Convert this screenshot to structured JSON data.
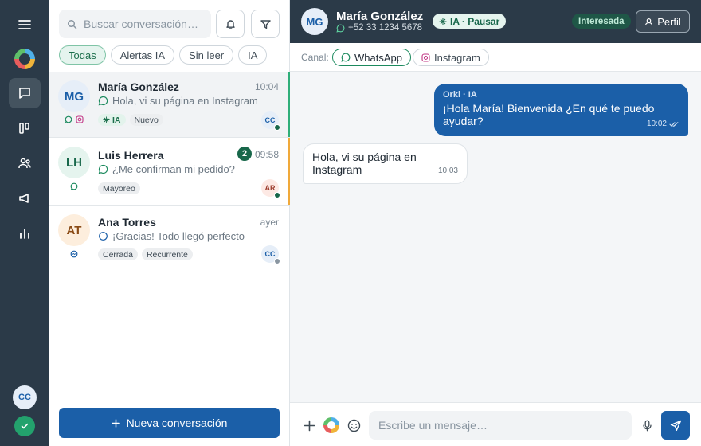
{
  "nav": {
    "items": [
      "menu-icon",
      "chat-icon",
      "board-icon",
      "users-icon",
      "megaphone-icon",
      "chart-icon"
    ],
    "active": "chat-icon",
    "user_initials": "CC",
    "status": "online"
  },
  "list": {
    "search_placeholder": "Buscar conversación…",
    "filters": [
      {
        "label": "Todas",
        "active": true
      },
      {
        "label": "Alertas IA",
        "active": false
      },
      {
        "label": "Sin leer",
        "active": false
      },
      {
        "label": "IA",
        "active": false
      }
    ],
    "conversations": [
      {
        "initials": "MG",
        "name": "María González",
        "time": "10:04",
        "preview": "Hola, vi su página en Instagram",
        "tags": [
          "IA",
          "Nuevo"
        ],
        "agent": "CC",
        "agent_status_color": "#17674a",
        "accent": "#2fae79",
        "channels": [
          "whatsapp",
          "instagram"
        ],
        "selected": true
      },
      {
        "initials": "LH",
        "name": "Luis Herrera",
        "time": "09:58",
        "unread": "2",
        "preview": "¿Me confirman mi pedido?",
        "tags": [
          "Mayoreo"
        ],
        "agent": "AR",
        "agent_status_color": "#17674a",
        "accent": "#f0a93a",
        "channels": [
          "whatsapp"
        ],
        "selected": false
      },
      {
        "initials": "AT",
        "name": "Ana Torres",
        "time": "ayer",
        "preview": "¡Gracias! Todo llegó perfecto",
        "tags": [
          "Cerrada",
          "Recurrente"
        ],
        "agent": "CC",
        "agent_status_color": "#8a96a1",
        "accent": "",
        "channels": [
          "messenger"
        ],
        "selected": false
      }
    ],
    "new_button": "Nueva conversación"
  },
  "chat": {
    "header": {
      "initials": "MG",
      "name": "María González",
      "phone": "+52 33 1234 5678",
      "ia_toggle": "IA · Pausar",
      "status": "Interesada",
      "profile_button": "Perfil"
    },
    "channel_label": "Canal:",
    "channels": [
      {
        "label": "WhatsApp",
        "active": true
      },
      {
        "label": "Instagram",
        "active": false
      }
    ],
    "messages": [
      {
        "direction": "out",
        "author": "Orki · IA",
        "text": "¡Hola María! Bienvenida ¿En qué te puedo ayudar?",
        "time": "10:02",
        "read": true
      },
      {
        "direction": "in",
        "text": "Hola, vi su página en Instagram",
        "time": "10:03"
      }
    ],
    "composer_placeholder": "Escribe un mensaje…"
  },
  "colors": {
    "rail": "#2b3a48",
    "primary": "#1b5fa8",
    "accent_green": "#17674a"
  }
}
